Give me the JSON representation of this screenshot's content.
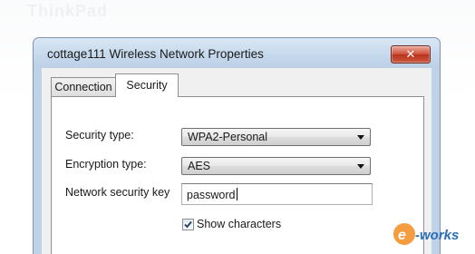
{
  "backdrop": {
    "ghost_title": "ThinkPad"
  },
  "dialog": {
    "title": "cottage111 Wireless Network Properties",
    "close_label": "✕"
  },
  "tabs": [
    {
      "label": "Connection",
      "selected": false
    },
    {
      "label": "Security",
      "selected": true
    }
  ],
  "security": {
    "security_type_label": "Security type:",
    "security_type_value": "WPA2-Personal",
    "encryption_type_label": "Encryption type:",
    "encryption_type_value": "AES",
    "network_key_label": "Network security key",
    "network_key_value": "password",
    "show_characters_label": "Show characters",
    "show_characters_checked": true
  },
  "watermark": {
    "text": "e-works",
    "colors": {
      "orange": "#f28c1e",
      "blue": "#2a6fb7"
    }
  }
}
